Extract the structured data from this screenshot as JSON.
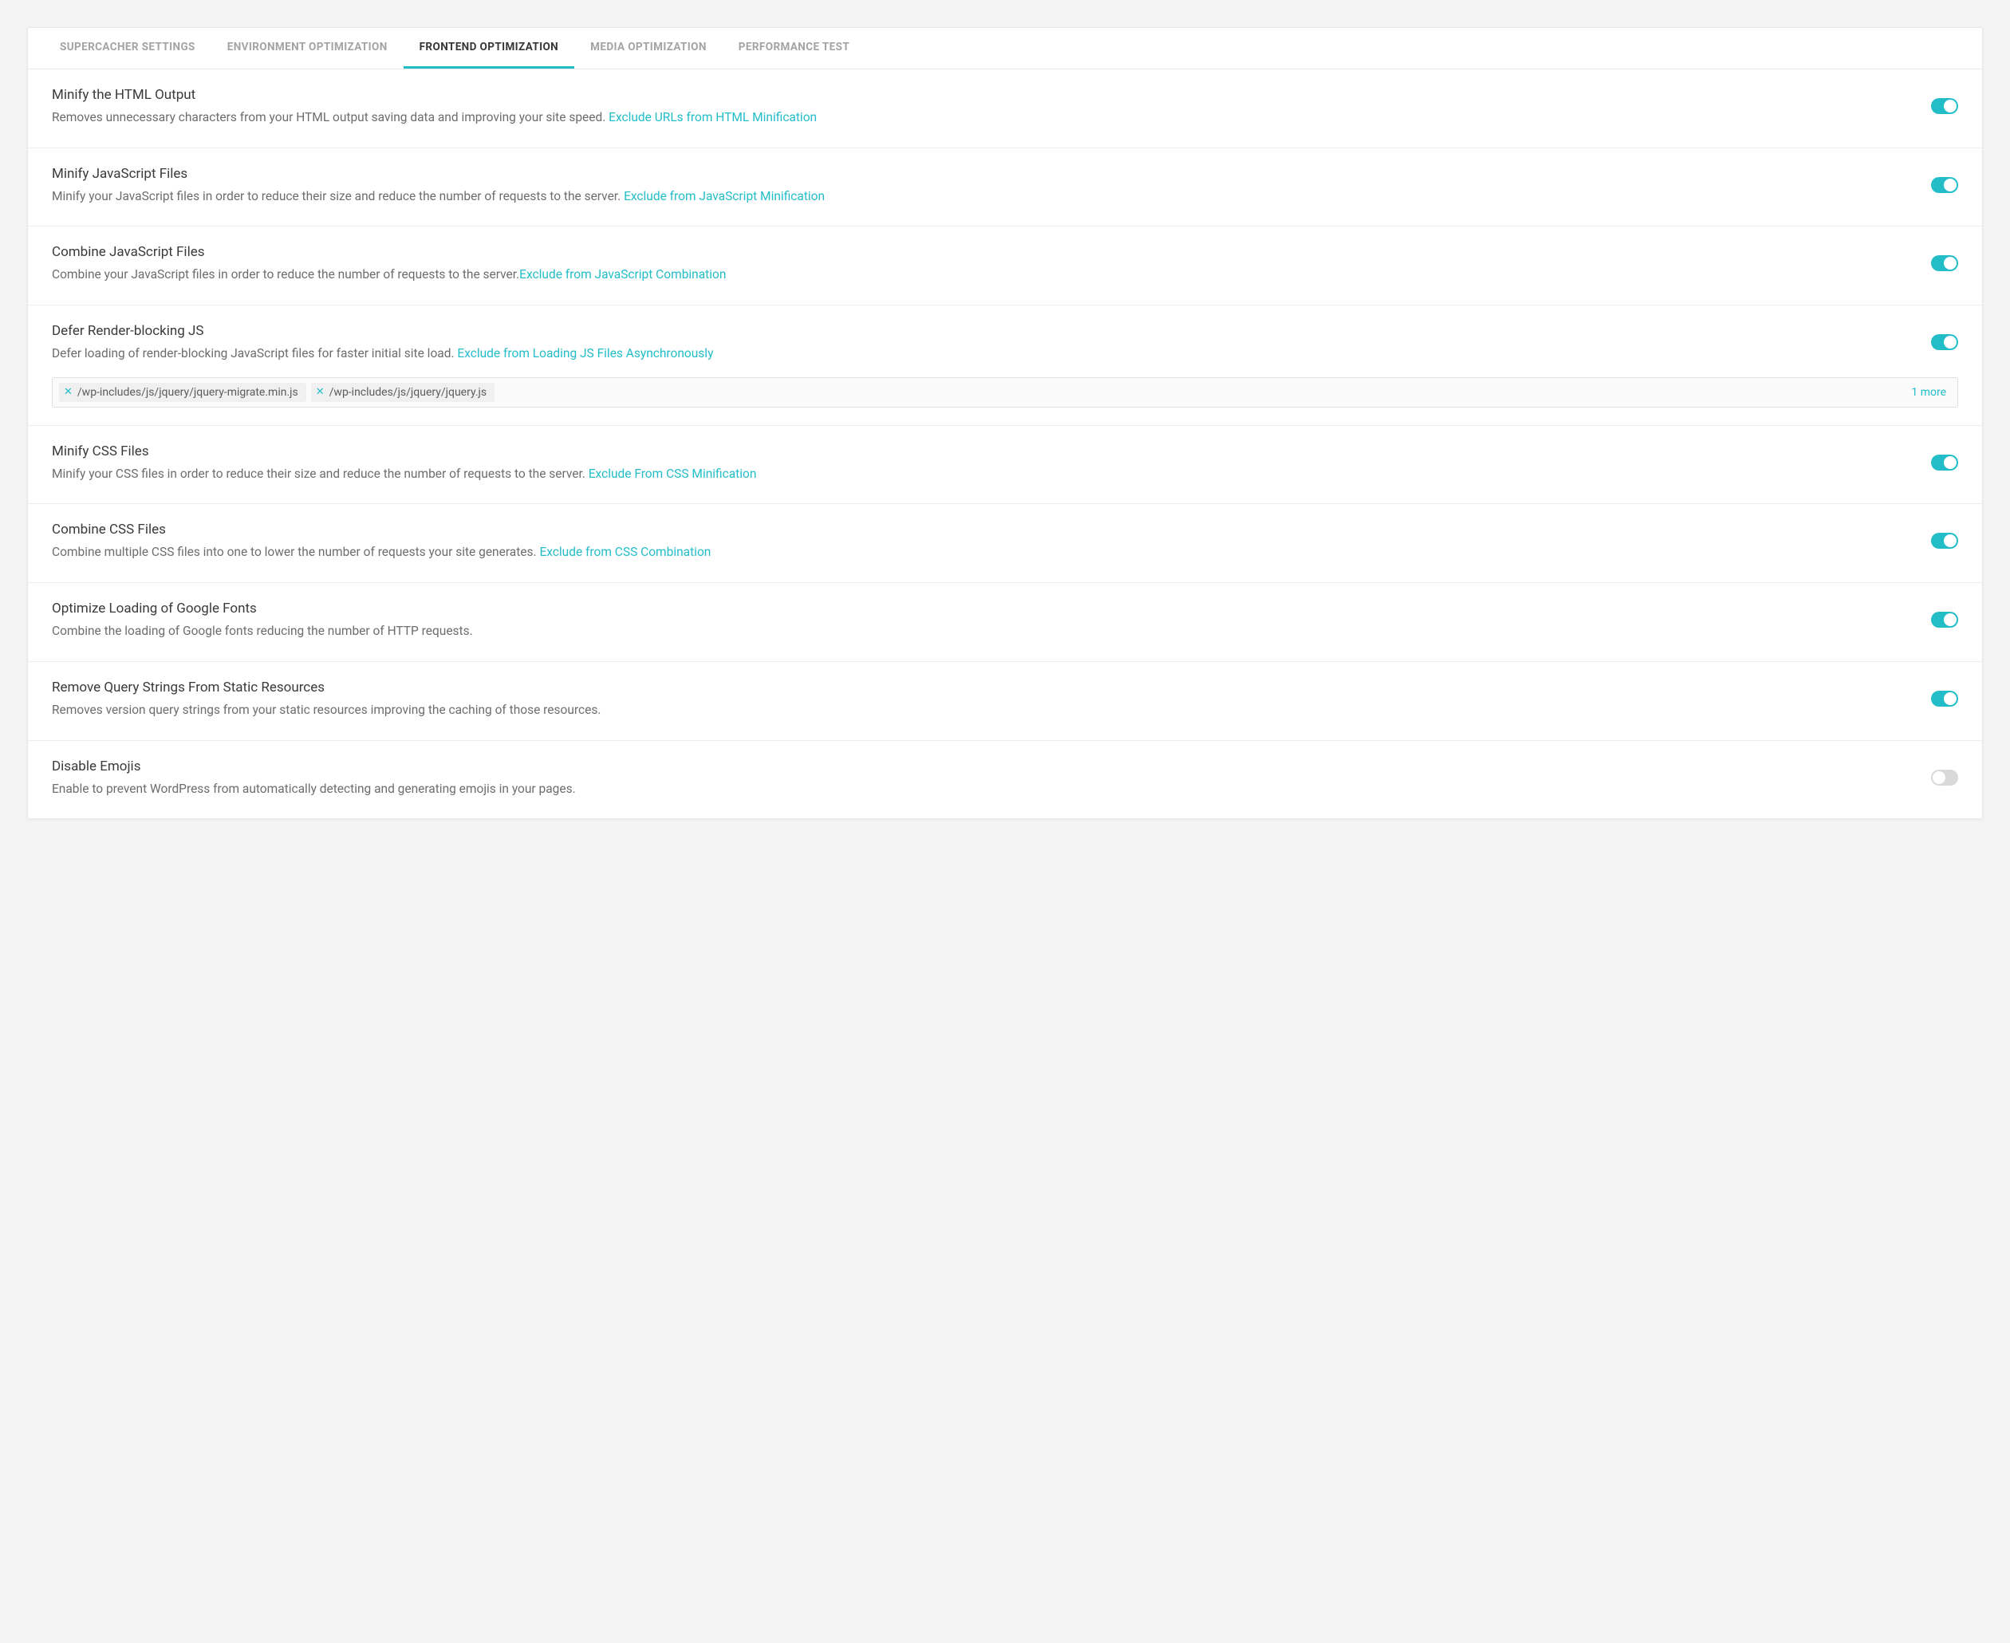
{
  "tabs": {
    "supercacher": "SUPERCACHER SETTINGS",
    "environment": "ENVIRONMENT OPTIMIZATION",
    "frontend": "FRONTEND OPTIMIZATION",
    "media": "MEDIA OPTIMIZATION",
    "performance": "PERFORMANCE TEST"
  },
  "settings": {
    "minify_html": {
      "title": "Minify the HTML Output",
      "desc": "Removes unnecessary characters from your HTML output saving data and improving your site speed. ",
      "link": "Exclude URLs from HTML Minification",
      "on": true
    },
    "minify_js": {
      "title": "Minify JavaScript Files",
      "desc": "Minify your JavaScript files in order to reduce their size and reduce the number of requests to the server. ",
      "link": "Exclude from JavaScript Minification",
      "on": true
    },
    "combine_js": {
      "title": "Combine JavaScript Files",
      "desc": "Combine your JavaScript files in order to reduce the number of requests to the server.",
      "link": "Exclude from JavaScript Combination",
      "on": true
    },
    "defer_js": {
      "title": "Defer Render-blocking JS",
      "desc": "Defer loading of render-blocking JavaScript files for faster initial site load. ",
      "link": "Exclude from Loading JS Files Asynchronously",
      "on": true,
      "chips": [
        "/wp-includes/js/jquery/jquery-migrate.min.js",
        "/wp-includes/js/jquery/jquery.js"
      ],
      "more": "1 more"
    },
    "minify_css": {
      "title": "Minify CSS Files",
      "desc": "Minify your CSS files in order to reduce their size and reduce the number of requests to the server. ",
      "link": "Exclude From CSS Minification",
      "on": true
    },
    "combine_css": {
      "title": "Combine CSS Files",
      "desc": "Combine multiple CSS files into one to lower the number of requests your site generates. ",
      "link": "Exclude from CSS Combination",
      "on": true
    },
    "google_fonts": {
      "title": "Optimize Loading of Google Fonts",
      "desc": "Combine the loading of Google fonts reducing the number of HTTP requests.",
      "on": true
    },
    "query_strings": {
      "title": "Remove Query Strings From Static Resources",
      "desc": "Removes version query strings from your static resources improving the caching of those resources.",
      "on": true
    },
    "disable_emojis": {
      "title": "Disable Emojis",
      "desc": "Enable to prevent WordPress from automatically detecting and generating emojis in your pages.",
      "on": false
    }
  }
}
